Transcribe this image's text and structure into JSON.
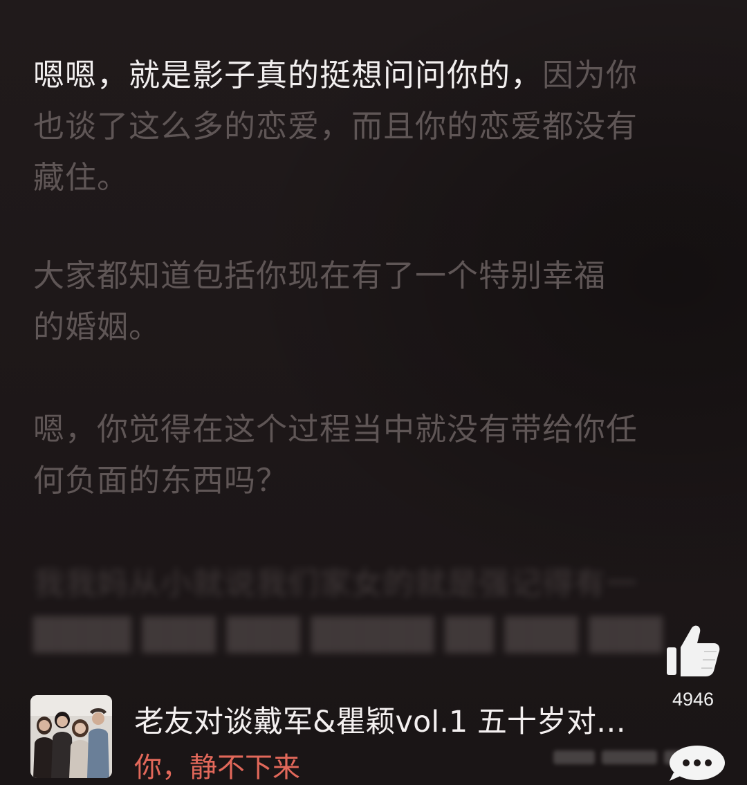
{
  "subtitles": {
    "p1_active": "嗯嗯，就是影子真的挺想问问你的，",
    "p1_rest_line1": "因为你",
    "p1_line2": "也谈了这么多的恋爱，而且你的恋爱都没有",
    "p1_line3": "藏住。",
    "p2_line1": "大家都知道包括你现在有了一个特别幸福",
    "p2_line2": "的婚姻。",
    "p3_line1": "嗯，你觉得在这个过程当中就没有带给你任",
    "p3_line2": "何负面的东西吗？",
    "p4_line1": "我我妈从小就说我们家女的就是强记得有一"
  },
  "like": {
    "icon": "thumbs-up-icon",
    "count": "4946"
  },
  "video": {
    "title": "老友对谈戴军&瞿颖vol.1 五十岁对…",
    "subtitle": "你，静不下来"
  },
  "more": {
    "icon": "more-dots-icon"
  },
  "colors": {
    "background": "#1e1819",
    "active_text": "#f2efef",
    "dim_text": "#5f5656",
    "accent": "#e2685a"
  }
}
